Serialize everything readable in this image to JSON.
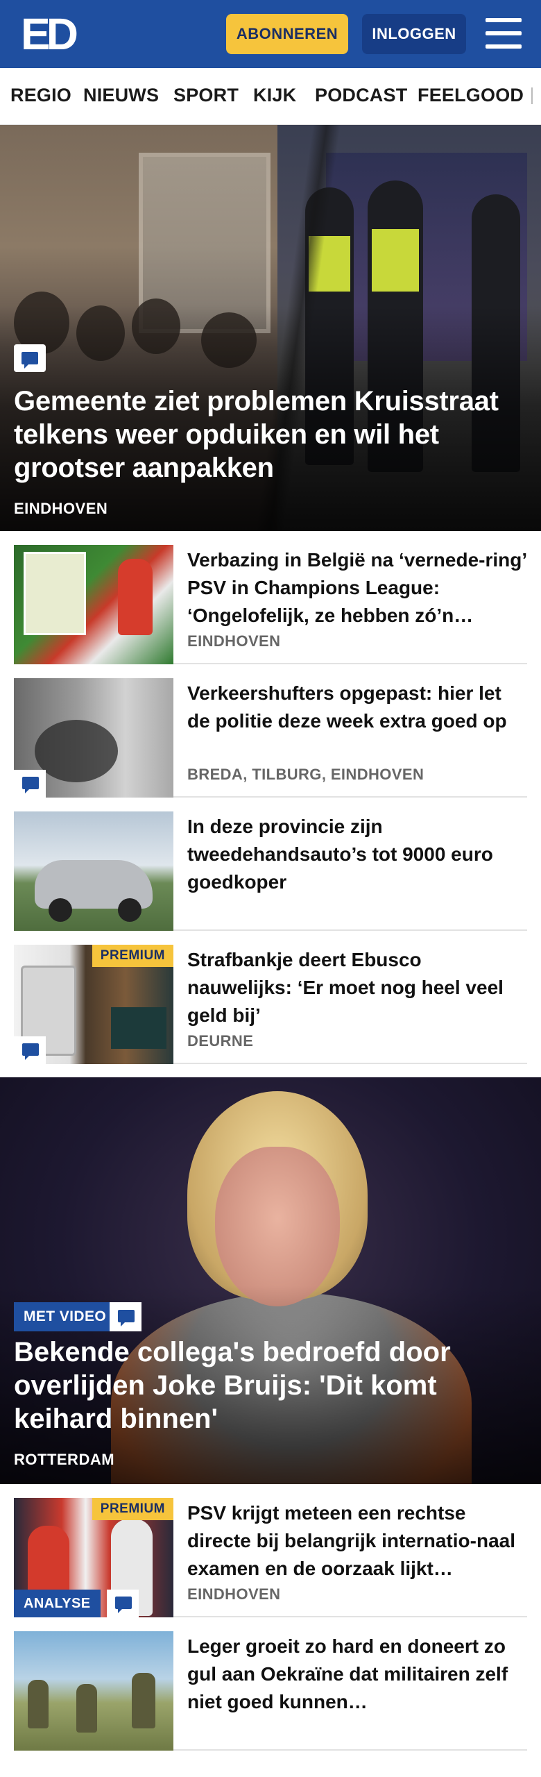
{
  "header": {
    "logo": "ED",
    "subscribe_label": "ABONNEREN",
    "login_label": "INLOGGEN",
    "menu_icon": "hamburger-menu-icon",
    "brand_color": "#1f4fa0",
    "accent_color": "#f6c43c"
  },
  "nav": {
    "items": [
      "REGIO",
      "NIEUWS",
      "SPORT",
      "KIJK",
      "PODCAST",
      "FEELGOOD"
    ]
  },
  "hero": {
    "title": "Gemeente ziet problemen Kruisstraat telkens weer opduiken en wil het grootser aanpakken",
    "tag": "EINDHOVEN",
    "icon": "comment-icon"
  },
  "articles": [
    {
      "title": "Verbazing in België na ‘vernede-ring’ PSV in Champions League: ‘Ongelofelijk, ze hebben zó’n…",
      "tag": "EINDHOVEN"
    },
    {
      "title": "Verkeershufters opgepast: hier let de politie deze week extra goed op",
      "tag": "BREDA, TILBURG, EINDHOVEN"
    },
    {
      "title": "In deze provincie zijn tweedehandsauto’s tot 9000 euro goedkoper",
      "tag": ""
    },
    {
      "title": "Strafbankje deert Ebusco nauwelijks: ‘Er moet nog heel veel geld bij’",
      "tag": "DEURNE",
      "badge": "PREMIUM"
    }
  ],
  "feature": {
    "badge": "MET VIDEO",
    "title": "Bekende collega's bedroefd door overlijden Joke Bruijs: 'Dit komt keihard binnen'",
    "tag": "ROTTERDAM"
  },
  "articles2": [
    {
      "title": "PSV krijgt meteen een rechtse directe bij belangrijk internatio-naal examen en de oorzaak lijkt…",
      "tag": "EINDHOVEN",
      "badge": "PREMIUM",
      "label": "ANALYSE"
    },
    {
      "title": "Leger groeit zo hard en doneert zo gul aan Oekraïne dat militairen zelf niet goed kunnen…",
      "tag": ""
    }
  ]
}
